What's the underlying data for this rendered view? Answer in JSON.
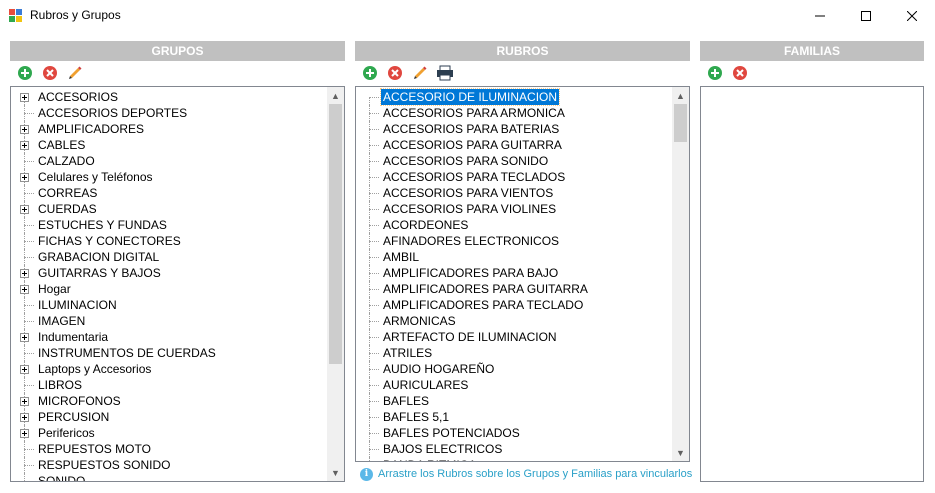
{
  "window": {
    "title": "Rubros y Grupos",
    "controls": {
      "minimize": "minimize-icon",
      "maximize": "maximize-icon",
      "close": "close-icon"
    }
  },
  "grupos": {
    "header": "GRUPOS",
    "items": [
      {
        "label": "ACCESORIOS",
        "expandable": true
      },
      {
        "label": "ACCESORIOS DEPORTES",
        "expandable": false
      },
      {
        "label": "AMPLIFICADORES",
        "expandable": true
      },
      {
        "label": "CABLES",
        "expandable": true
      },
      {
        "label": "CALZADO",
        "expandable": false
      },
      {
        "label": "Celulares y Teléfonos",
        "expandable": true
      },
      {
        "label": "CORREAS",
        "expandable": false
      },
      {
        "label": "CUERDAS",
        "expandable": true
      },
      {
        "label": "ESTUCHES Y FUNDAS",
        "expandable": false
      },
      {
        "label": "FICHAS Y CONECTORES",
        "expandable": false
      },
      {
        "label": "GRABACION DIGITAL",
        "expandable": false
      },
      {
        "label": "GUITARRAS Y BAJOS",
        "expandable": true
      },
      {
        "label": "Hogar",
        "expandable": true
      },
      {
        "label": "ILUMINACION",
        "expandable": false
      },
      {
        "label": "IMAGEN",
        "expandable": false
      },
      {
        "label": "Indumentaria",
        "expandable": true
      },
      {
        "label": "INSTRUMENTOS DE CUERDAS",
        "expandable": false
      },
      {
        "label": "Laptops y Accesorios",
        "expandable": true
      },
      {
        "label": "LIBROS",
        "expandable": false
      },
      {
        "label": "MICROFONOS",
        "expandable": true
      },
      {
        "label": "PERCUSION",
        "expandable": true
      },
      {
        "label": "Perifericos",
        "expandable": true
      },
      {
        "label": "REPUESTOS MOTO",
        "expandable": false
      },
      {
        "label": "RESPUESTOS SONIDO",
        "expandable": false
      },
      {
        "label": "SONIDO",
        "expandable": false
      }
    ]
  },
  "rubros": {
    "header": "RUBROS",
    "selected": "ACCESORIO DE ILUMINACION",
    "items": [
      "ACCESORIO DE ILUMINACION",
      "ACCESORIOS PARA ARMONICA",
      "ACCESORIOS PARA BATERIAS",
      "ACCESORIOS PARA GUITARRA",
      "ACCESORIOS PARA SONIDO",
      "ACCESORIOS PARA TECLADOS",
      "ACCESORIOS PARA VIENTOS",
      "ACCESORIOS PARA VIOLINES",
      "ACORDEONES",
      "AFINADORES ELECTRONICOS",
      "AMBIL",
      "AMPLIFICADORES PARA BAJO",
      "AMPLIFICADORES PARA GUITARRA",
      "AMPLIFICADORES PARA TECLADO",
      "ARMONICAS",
      "ARTEFACTO DE ILUMINACION",
      "ATRILES",
      "AUDIO HOGAREÑO",
      "AURICULARES",
      "BAFLES",
      "BAFLES 5,1",
      "BAFLES POTENCIADOS",
      "BAJOS ELECTRICOS",
      "BANDA RITMICA"
    ],
    "hint": "Arrastre los Rubros sobre los Grupos y Familias para vincularlos"
  },
  "familias": {
    "header": "FAMILIAS",
    "items": []
  },
  "colors": {
    "header_bg": "#c0c0c0",
    "add_green": "#2fa84f",
    "delete_red": "#e0473f",
    "selection": "#0078d7",
    "hint_text": "#2aa0c8"
  },
  "icons": {
    "add": "add-icon",
    "delete": "delete-icon",
    "edit": "pencil-icon",
    "print": "printer-icon",
    "info": "info-icon"
  }
}
